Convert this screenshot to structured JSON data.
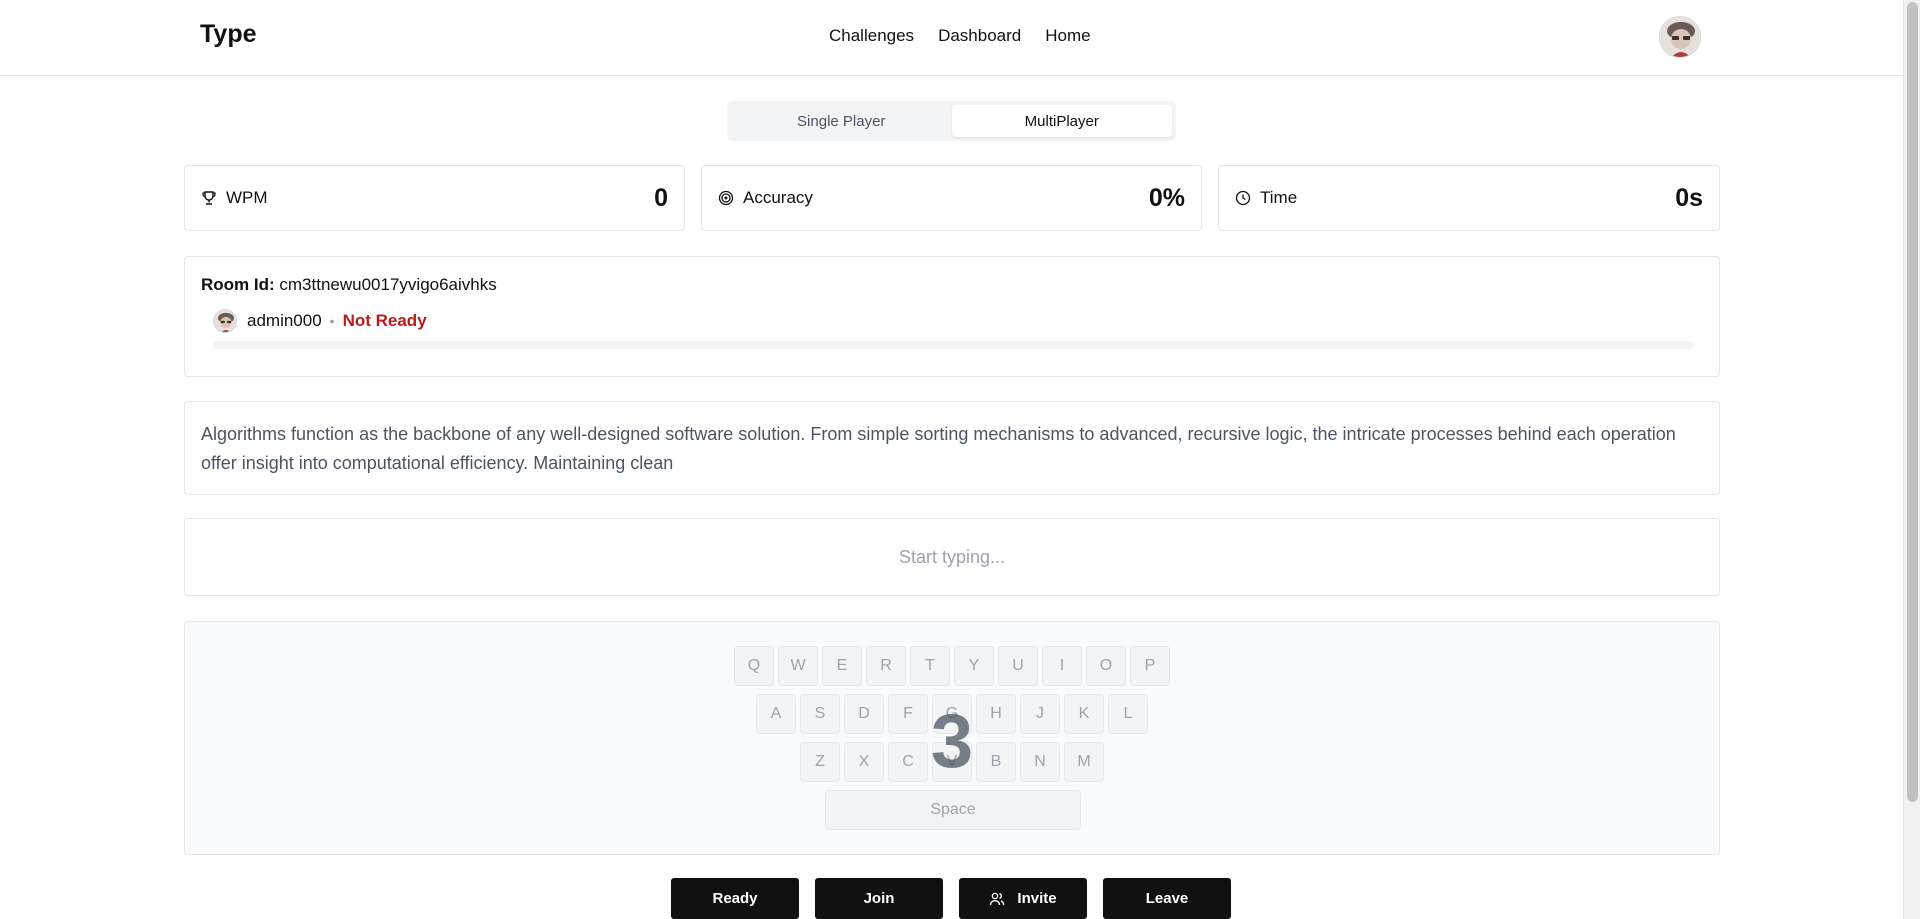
{
  "app": {
    "brand": "Type"
  },
  "nav": {
    "items": [
      "Challenges",
      "Dashboard",
      "Home"
    ]
  },
  "mode": {
    "single": "Single Player",
    "multi": "MultiPlayer",
    "active": "MultiPlayer"
  },
  "stats": {
    "wpm": {
      "label": "WPM",
      "value": "0",
      "icon": "trophy-icon"
    },
    "accuracy": {
      "label": "Accuracy",
      "value": "0%",
      "icon": "target-icon"
    },
    "time": {
      "label": "Time",
      "value": "0s",
      "icon": "clock-icon"
    }
  },
  "room": {
    "id_label": "Room Id:",
    "id_value": "cm3ttnewu0017yvigo6aivhks",
    "players": [
      {
        "name": "admin000",
        "status": "Not Ready",
        "progress": 0
      }
    ],
    "separator": "•"
  },
  "passage": "Algorithms function as the backbone of any well-designed software solution. From simple sorting mechanisms to advanced, recursive logic, the intricate processes behind each operation offer insight into computational efficiency. Maintaining clean",
  "typing": {
    "placeholder": "Start typing..."
  },
  "keyboard": {
    "row1": [
      "Q",
      "W",
      "E",
      "R",
      "T",
      "Y",
      "U",
      "I",
      "O",
      "P"
    ],
    "row2": [
      "A",
      "S",
      "D",
      "F",
      "G",
      "H",
      "J",
      "K",
      "L"
    ],
    "row3": [
      "Z",
      "X",
      "C",
      "V",
      "B",
      "N",
      "M"
    ],
    "space": "Space",
    "countdown": "3"
  },
  "actions": {
    "ready": "Ready",
    "join": "Join",
    "invite": "Invite",
    "leave": "Leave",
    "invite_icon": "users-icon"
  },
  "colors": {
    "primary": "#111111",
    "not_ready": "#b91c1c",
    "border": "#e5e7eb"
  }
}
